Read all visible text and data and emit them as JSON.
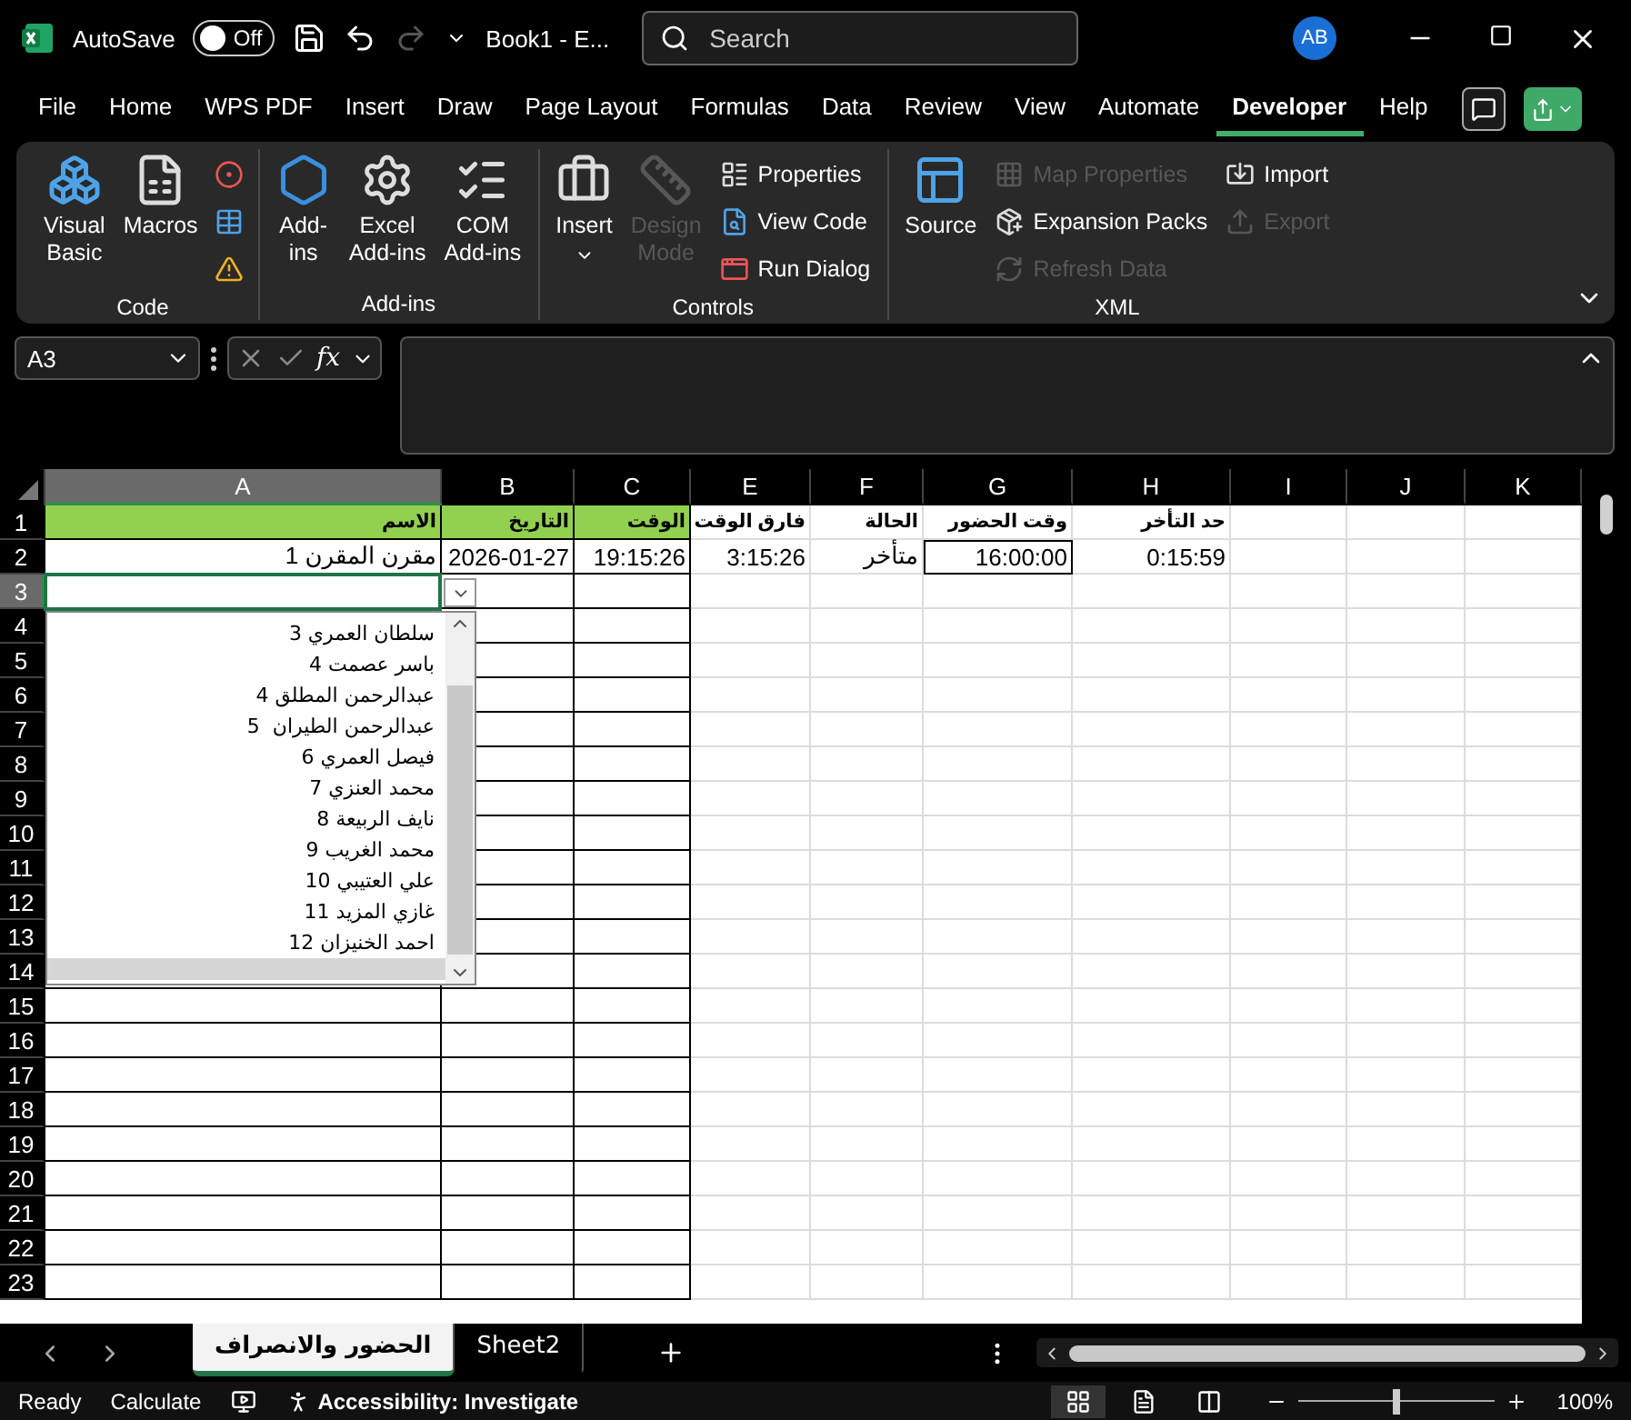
{
  "title_bar": {
    "autosave_label": "AutoSave",
    "autosave_toggle": {
      "label": "Off",
      "on": false
    },
    "redo_disabled": true,
    "document_title": "Book1  -  E...",
    "search": {
      "placeholder": "Search"
    },
    "avatar": "AB"
  },
  "ribbon_tabs": [
    {
      "label": "File",
      "selected": false
    },
    {
      "label": "Home",
      "selected": false
    },
    {
      "label": "WPS PDF",
      "selected": false
    },
    {
      "label": "Insert",
      "selected": false
    },
    {
      "label": "Draw",
      "selected": false
    },
    {
      "label": "Page Layout",
      "selected": false
    },
    {
      "label": "Formulas",
      "selected": false
    },
    {
      "label": "Data",
      "selected": false
    },
    {
      "label": "Review",
      "selected": false
    },
    {
      "label": "View",
      "selected": false
    },
    {
      "label": "Automate",
      "selected": false
    },
    {
      "label": "Developer",
      "selected": true
    },
    {
      "label": "Help",
      "selected": false
    }
  ],
  "ribbon": {
    "groups": [
      {
        "label": "Code",
        "items": [
          {
            "kind": "large",
            "label": "Visual\nBasic",
            "disabled": false
          },
          {
            "kind": "large",
            "label": "Macros",
            "disabled": false
          },
          {
            "kind": "icon",
            "disabled": false
          },
          {
            "kind": "icon",
            "disabled": false
          },
          {
            "kind": "icon",
            "disabled": false
          }
        ]
      },
      {
        "label": "Add-ins",
        "items": [
          {
            "kind": "large",
            "label": "Add-\nins",
            "disabled": false
          },
          {
            "kind": "large",
            "label": "Excel\nAdd-ins",
            "disabled": false
          },
          {
            "kind": "large",
            "label": "COM\nAdd-ins",
            "disabled": false
          }
        ]
      },
      {
        "label": "Controls",
        "items": [
          {
            "kind": "menu",
            "label": "Insert",
            "disabled": false
          },
          {
            "kind": "large",
            "label": "Design\nMode",
            "disabled": true
          },
          {
            "kind": "small",
            "label": "Properties",
            "disabled": false
          },
          {
            "kind": "small",
            "label": "View Code",
            "disabled": false
          },
          {
            "kind": "small",
            "label": "Run Dialog",
            "disabled": false
          }
        ]
      },
      {
        "label": "XML",
        "items": [
          {
            "kind": "large",
            "label": "Source",
            "disabled": false
          },
          {
            "kind": "small",
            "label": "Map Properties",
            "disabled": true
          },
          {
            "kind": "small",
            "label": "Expansion Packs",
            "disabled": false
          },
          {
            "kind": "small",
            "label": "Refresh Data",
            "disabled": true
          },
          {
            "kind": "small",
            "label": "Import",
            "disabled": false
          },
          {
            "kind": "small",
            "label": "Export",
            "disabled": true
          }
        ]
      }
    ]
  },
  "formula_bar": {
    "name_box": "A3",
    "function_label": "fx"
  },
  "sheet": {
    "columns": [
      {
        "label": "A",
        "selected": true
      },
      {
        "label": "B",
        "selected": false
      },
      {
        "label": "C",
        "selected": false
      },
      {
        "label": "E",
        "selected": false
      },
      {
        "label": "F",
        "selected": false
      },
      {
        "label": "G",
        "selected": false
      },
      {
        "label": "H",
        "selected": false
      },
      {
        "label": "I",
        "selected": false
      },
      {
        "label": "J",
        "selected": false
      },
      {
        "label": "K",
        "selected": false
      }
    ],
    "rows": [
      {
        "label": "1",
        "selected": false,
        "cells": {
          "A": {
            "text": "الاسم",
            "kind": "banner"
          },
          "B": {
            "text": "التاريخ",
            "kind": "banner"
          },
          "C": {
            "text": "الوقت",
            "kind": "banner"
          },
          "E": {
            "text": "فارق الوقت",
            "kind": "heading"
          },
          "F": {
            "text": "الحالة",
            "kind": "heading"
          },
          "G": {
            "text": "وقت الحضور",
            "kind": "heading"
          },
          "H": {
            "text": "حد التأخر",
            "kind": "heading"
          }
        }
      },
      {
        "label": "2",
        "selected": false,
        "cells": {
          "A": {
            "text": "مقرن المقرن 1",
            "kind": "value"
          },
          "B": {
            "text": "2026-01-27",
            "kind": "value"
          },
          "C": {
            "text": "19:15:26",
            "kind": "value"
          },
          "E": {
            "text": "3:15:26",
            "kind": "value"
          },
          "F": {
            "text": "متأخر",
            "kind": "value"
          },
          "G": {
            "text": "16:00:00",
            "kind": "framed"
          },
          "H": {
            "text": "0:15:59",
            "kind": "value"
          }
        }
      },
      {
        "label": "3",
        "selected": true
      },
      {
        "label": "4",
        "selected": false
      },
      {
        "label": "5",
        "selected": false
      },
      {
        "label": "6",
        "selected": false
      },
      {
        "label": "7",
        "selected": false
      },
      {
        "label": "8",
        "selected": false
      },
      {
        "label": "9",
        "selected": false
      },
      {
        "label": "10",
        "selected": false
      },
      {
        "label": "11",
        "selected": false
      },
      {
        "label": "12",
        "selected": false
      },
      {
        "label": "13",
        "selected": false
      },
      {
        "label": "14",
        "selected": false
      },
      {
        "label": "15",
        "selected": false
      },
      {
        "label": "16",
        "selected": false
      },
      {
        "label": "17",
        "selected": false
      },
      {
        "label": "18",
        "selected": false
      },
      {
        "label": "19",
        "selected": false
      },
      {
        "label": "20",
        "selected": false
      },
      {
        "label": "21",
        "selected": false
      },
      {
        "label": "22",
        "selected": false
      },
      {
        "label": "23",
        "selected": false
      }
    ]
  },
  "validation_list": {
    "items": [
      "سلطان العمري 3",
      "باسر عصمت 4",
      "عبدالرحمن المطلق 4",
      "عبدالرحمن الطيران  5",
      "فيصل العمري 6",
      "محمد العنزي 7",
      "نايف الربيعة 8",
      "محمد الغريب 9",
      "علي العتيبي 10",
      "غازي المزيد 11",
      "احمد الخنيزان 12"
    ]
  },
  "sheet_tabs": [
    {
      "label": "الحضور والانصراف",
      "selected": true
    },
    {
      "label": "Sheet2",
      "selected": false
    }
  ],
  "status_bar": {
    "mode": "Ready",
    "calculate": "Calculate",
    "accessibility": "Accessibility: Investigate",
    "views": [
      {
        "selected": true
      },
      {
        "selected": false
      },
      {
        "selected": false
      }
    ],
    "zoom": {
      "level": 0.5,
      "label": "100%"
    }
  }
}
